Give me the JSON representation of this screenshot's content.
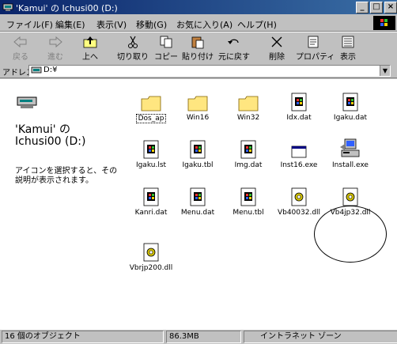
{
  "window": {
    "title": "'Kamui' の Ichusi00 (D:)",
    "buttons": [
      "_",
      "□",
      "×"
    ]
  },
  "menu": {
    "items": [
      "ファイル(F)",
      "編集(E)",
      "表示(V)",
      "移動(G)",
      "お気に入り(A)",
      "ヘルプ(H)"
    ]
  },
  "toolbar": {
    "back": "戻る",
    "forward": "進む",
    "up": "上へ",
    "cut": "切り取り",
    "copy": "コピー",
    "paste": "貼り付け",
    "undo": "元に戻す",
    "delete": "削除",
    "properties": "プロパティ",
    "view": "表示"
  },
  "address": {
    "label": "アドレス",
    "value": "D:¥"
  },
  "left_pane": {
    "name_line1": "'Kamui' の",
    "name_line2": "Ichusi00 (D:)",
    "info": "アイコンを選択すると、その説明が表示されます。"
  },
  "files": [
    {
      "name": "Dos_ap",
      "type": "folder"
    },
    {
      "name": "Win16",
      "type": "folder"
    },
    {
      "name": "Win32",
      "type": "folder"
    },
    {
      "name": "Idx.dat",
      "type": "dat"
    },
    {
      "name": "Igaku.dat",
      "type": "dat"
    },
    {
      "name": "Igaku.lst",
      "type": "dat"
    },
    {
      "name": "Igaku.tbl",
      "type": "dat"
    },
    {
      "name": "Img.dat",
      "type": "dat"
    },
    {
      "name": "Inst16.exe",
      "type": "window"
    },
    {
      "name": "Install.exe",
      "type": "install"
    },
    {
      "name": "Kanri.dat",
      "type": "dat"
    },
    {
      "name": "Menu.dat",
      "type": "dat"
    },
    {
      "name": "Menu.tbl",
      "type": "dat"
    },
    {
      "name": "Vb40032.dll",
      "type": "dll"
    },
    {
      "name": "Vb4jp32.dll",
      "type": "dll"
    },
    {
      "name": "Vbrjp200.dll",
      "type": "dll"
    }
  ],
  "status": {
    "count": "16 個のオブジェクト",
    "size": "86.3MB",
    "zone": "イントラネット ゾーン"
  }
}
